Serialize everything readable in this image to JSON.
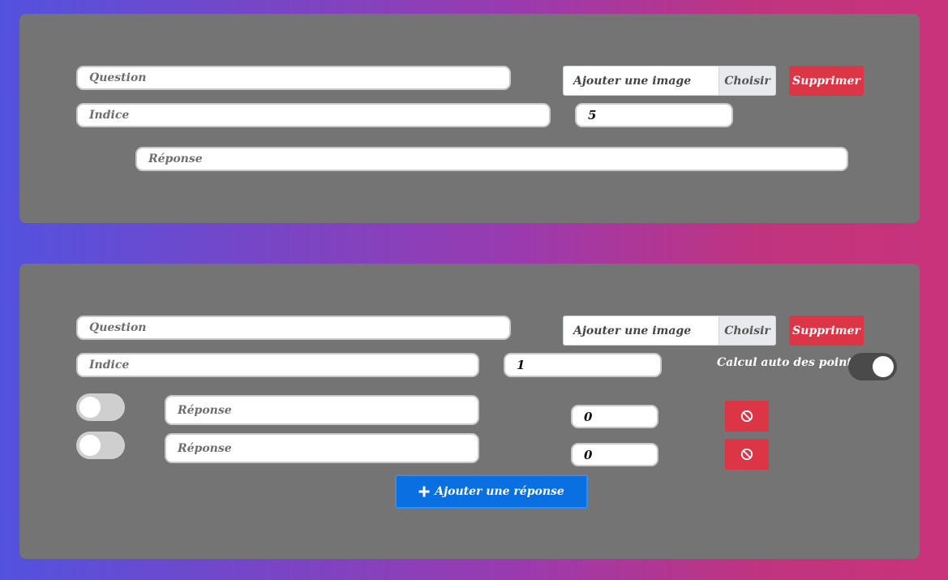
{
  "question_block_1": {
    "question_placeholder": "Question",
    "image_label": "Ajouter une image",
    "choose_label": "Choisir",
    "delete_label": "Supprimer",
    "hint_placeholder": "Indice",
    "points_value": "5",
    "answer_placeholder": "Réponse"
  },
  "question_block_2": {
    "question_placeholder": "Question",
    "image_label": "Ajouter une image",
    "choose_label": "Choisir",
    "delete_label": "Supprimer",
    "hint_placeholder": "Indice",
    "points_value": "1",
    "auto_points_label": "Calcul auto des points",
    "auto_points_enabled": true,
    "answers": [
      {
        "placeholder": "Réponse",
        "points": "0",
        "correct": false
      },
      {
        "placeholder": "Réponse",
        "points": "0",
        "correct": false
      }
    ],
    "add_answer_label": "Ajouter une réponse"
  },
  "icons": {
    "remove": "ban-icon",
    "add": "plus-icon"
  },
  "colors": {
    "danger": "#dc3545",
    "primary": "#0a6fe0",
    "card": "#747474"
  }
}
